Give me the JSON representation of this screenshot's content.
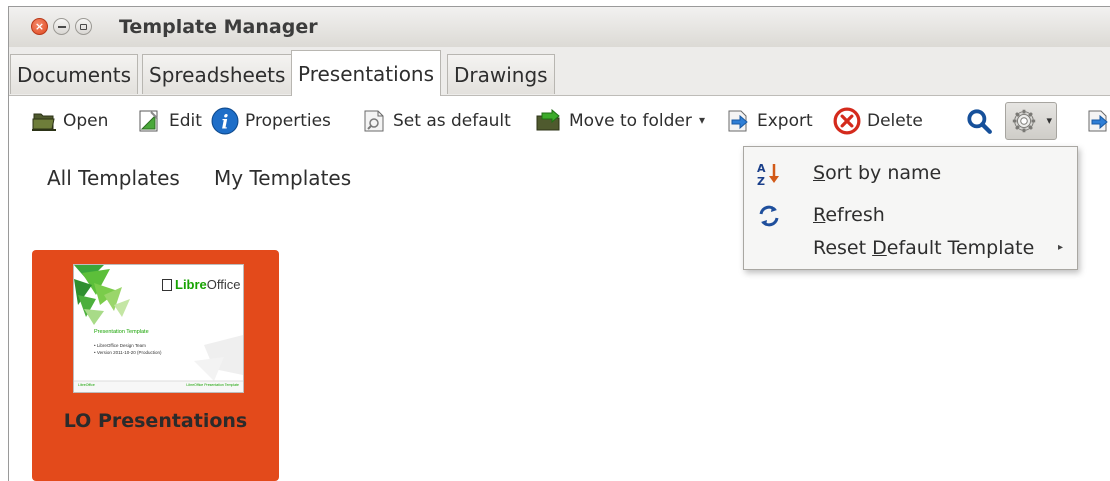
{
  "window": {
    "title": "Template Manager",
    "close_symbol": "×"
  },
  "tabs": [
    {
      "label": "Documents",
      "active": false
    },
    {
      "label": "Spreadsheets",
      "active": false
    },
    {
      "label": "Presentations",
      "active": true
    },
    {
      "label": "Drawings",
      "active": false
    }
  ],
  "toolbar": {
    "open": {
      "label": "Open",
      "icon": "open-icon"
    },
    "edit": {
      "label": "Edit",
      "icon": "edit-icon"
    },
    "properties": {
      "label": "Properties",
      "icon": "info-icon"
    },
    "set_default": {
      "label": "Set as default",
      "icon": "set-default-icon"
    },
    "move": {
      "label": "Move to folder",
      "icon": "move-to-folder-icon"
    },
    "export": {
      "label": "Export",
      "icon": "export-icon"
    },
    "delete": {
      "label": "Delete",
      "icon": "delete-icon"
    },
    "dropdown_arrow": "▾",
    "search_icon": "search-icon",
    "settings_icon": "gear-icon"
  },
  "folders": {
    "all": "All Templates",
    "mine": "My Templates"
  },
  "templates": [
    {
      "name": "LO Presentations",
      "thumbnail": {
        "brand_prefix": "Libre",
        "brand_suffix": "Office",
        "title": "Presentation Template",
        "line1": "• LibreOffice Design Team",
        "line2": "• Version 2011-10-20 (Production)",
        "footer_left": "LibreOffice",
        "footer_right": "LibreOffice Presentation Template"
      }
    }
  ],
  "menu": {
    "sort": {
      "pre": "",
      "mnemonic": "S",
      "post": "ort by name",
      "icon": "sort-az-icon"
    },
    "refresh": {
      "pre": "",
      "mnemonic": "R",
      "post": "efresh",
      "icon": "refresh-icon"
    },
    "reset": {
      "pre": "Reset ",
      "mnemonic": "D",
      "post": "efault Template",
      "submenu_arrow": "▸"
    }
  },
  "colors": {
    "thumbnail_card": "#e34a1b",
    "libreoffice_green": "#18a303",
    "info_blue": "#1e6ec8",
    "delete_red": "#d42a1c"
  }
}
